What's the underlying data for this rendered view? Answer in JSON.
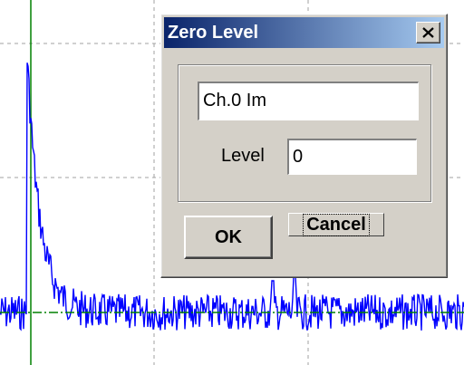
{
  "dialog": {
    "title": "Zero Level",
    "close_icon": "close-x-icon",
    "channel_name": "Ch.0 Im",
    "level_label": "Level",
    "level_value": "0",
    "ok_label": "OK",
    "cancel_label": "Cancel"
  },
  "colors": {
    "signal": "#0000ff",
    "zero_line": "#008000",
    "grid": "#a0a0a0",
    "title_gradient_start": "#0a246a",
    "title_gradient_end": "#a6caf0"
  }
}
